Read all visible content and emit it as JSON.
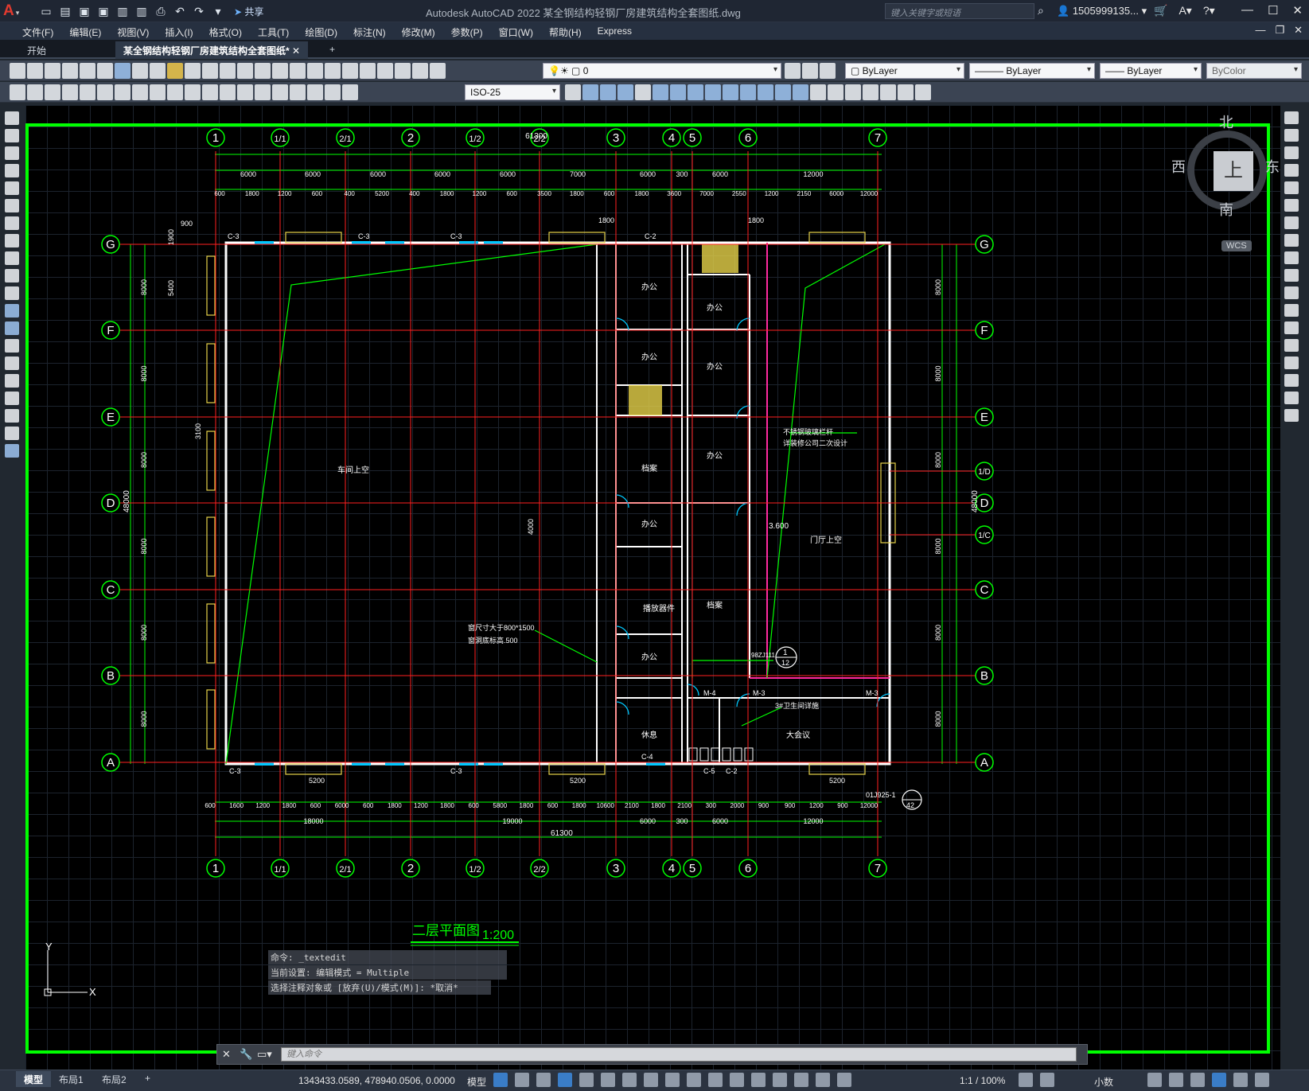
{
  "titlebar": {
    "app_title": "Autodesk AutoCAD 2022    某全钢结构轻钢厂房建筑结构全套图纸.dwg",
    "share_label": "共享",
    "search_placeholder": "键入关键字或短语",
    "user": "1505999135..."
  },
  "menu": [
    "文件(F)",
    "编辑(E)",
    "视图(V)",
    "插入(I)",
    "格式(O)",
    "工具(T)",
    "绘图(D)",
    "标注(N)",
    "修改(M)",
    "参数(P)",
    "窗口(W)",
    "帮助(H)",
    "Express"
  ],
  "tabs": {
    "start": "开始",
    "active": "某全钢结构轻钢厂房建筑结构全套图纸*",
    "add": "+"
  },
  "toolbar": {
    "layer_value": "0",
    "color": "ByLayer",
    "linetype": "ByLayer",
    "lineweight": "ByLayer",
    "plotstyle": "ByColor",
    "dimstyle": "ByColor",
    "dim_style": "ISO-25"
  },
  "viewcube": {
    "north": "北",
    "south": "南",
    "east": "东",
    "west": "西",
    "top": "上",
    "wcs": "WCS"
  },
  "drawing": {
    "axes_top": [
      "1",
      "1/1",
      "2/1",
      "2",
      "1/2",
      "2/2",
      "3",
      "4",
      "5",
      "6",
      "7"
    ],
    "axes_left": [
      "G",
      "F",
      "E",
      "D",
      "C",
      "B",
      "A"
    ],
    "axes_right_extra": [
      "1/D",
      "1/C"
    ],
    "total_width": "61300",
    "total_height": "48000",
    "top_dims_1": [
      "6000",
      "6000",
      "6000",
      "6000",
      "6000",
      "7000",
      "6000",
      "300",
      "6000",
      "12000"
    ],
    "top_dims_2": [
      "600",
      "1800",
      "1200",
      "600",
      "400",
      "5200",
      "400",
      "1800",
      "1200",
      "600",
      "3500",
      "1800",
      "600",
      "1800",
      "3600",
      "7000",
      "2550",
      "1200",
      "2150",
      "6000",
      "12000"
    ],
    "bottom_dims_1": [
      "600",
      "1600",
      "1200",
      "1800",
      "600",
      "6000",
      "600",
      "1800",
      "1200",
      "1800",
      "600",
      "5800",
      "1800",
      "600",
      "1800",
      "10600",
      "2100",
      "1800",
      "2100",
      "300",
      "2000",
      "900",
      "900",
      "1200",
      "900",
      "12000"
    ],
    "bottom_dims_2": [
      "18000",
      "19000",
      "6000",
      "300",
      "6000",
      "12000"
    ],
    "side_dims": [
      "8000",
      "8000",
      "8000",
      "8000",
      "8000",
      "8000"
    ],
    "rooms": [
      "办公",
      "办公",
      "办公",
      "办公",
      "档案",
      "办公",
      "档案",
      "办公",
      "办公",
      "档案",
      "休息",
      "车间上空",
      "门厅上空",
      "大会议",
      "播放器件"
    ],
    "labels": [
      "C-3",
      "C-4",
      "C-2",
      "C-5",
      "M-3",
      "M-4",
      "M-5"
    ],
    "notes": [
      "不锈钢玻璃栏杆",
      "详装修公司二次设计",
      "窗尺寸大于800*1500",
      "窗洞底标高.500",
      "3.600",
      "3#卫生间详施",
      "01J925-1",
      "98ZJ111"
    ],
    "small_dims": [
      "900",
      "5400",
      "1900",
      "3100",
      "1800",
      "4000",
      "5200",
      "900",
      "1200"
    ],
    "detail_ref": [
      "1",
      "12",
      "42"
    ],
    "title": "二层平面图",
    "scale": "1:200"
  },
  "command": {
    "history": [
      "命令: _textedit",
      "当前设置: 编辑模式 = Multiple",
      "选择注释对象或 [放弃(U)/模式(M)]: *取消*"
    ],
    "placeholder": "键入命令"
  },
  "status": {
    "layout_tabs": [
      "模型",
      "布局1",
      "布局2"
    ],
    "coords": "1343433.0589, 478940.0506, 0.0000",
    "space": "模型",
    "scale": "1:1 / 100%",
    "units": "小数"
  },
  "colors": {
    "green": "#00ff00",
    "red": "#ff2020",
    "white": "#ffffff",
    "yellow": "#ffff40",
    "cyan": "#00c8ff"
  }
}
